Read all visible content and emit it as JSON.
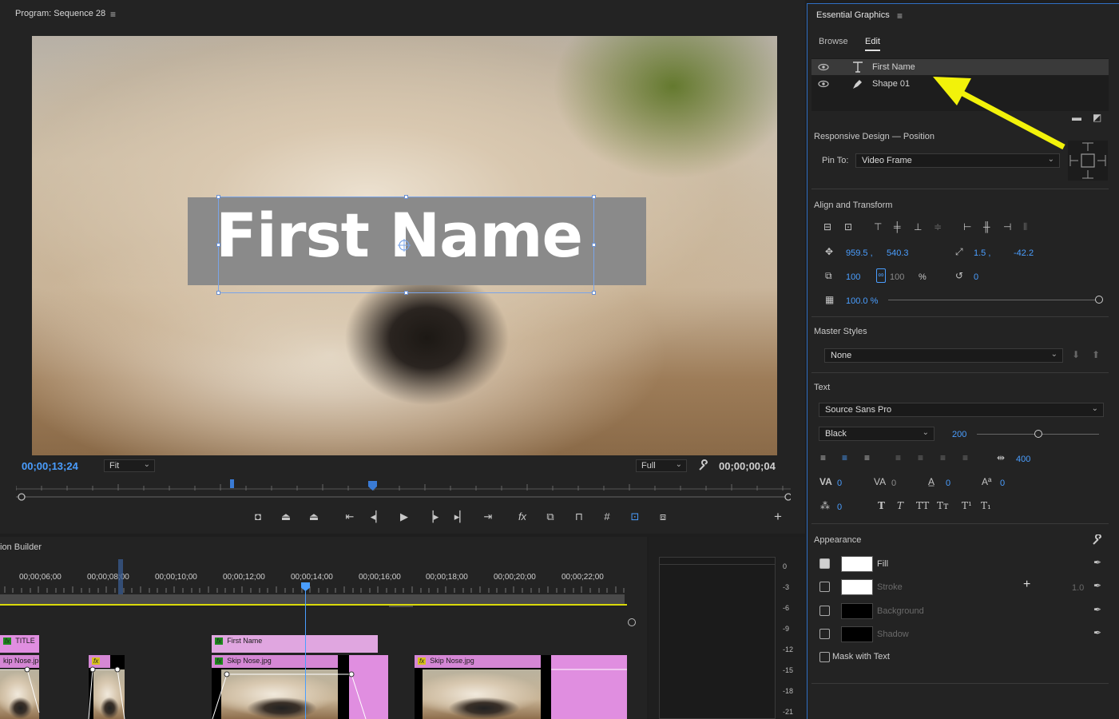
{
  "program": {
    "title": "Program: Sequence 28",
    "timecode_current": "00;00;13;24",
    "fit_value": "Fit",
    "resolution_value": "Full",
    "timecode_duration": "00;00;00;04",
    "title_overlay_text": "First Name"
  },
  "timeline": {
    "title": "ion Builder",
    "ruler_labels": [
      "00;00;06;00",
      "00;00;08;00",
      "00;00;10;00",
      "00;00;12;00",
      "00;00;14;00",
      "00;00;16;00",
      "00;00;18;00",
      "00;00;20;00",
      "00;00;22;00"
    ],
    "clips": {
      "title_clip": "TITLE",
      "first_name_clip": "First Name",
      "skip_nose_left": "kip Nose.jp",
      "skip_nose_mid": "Skip Nose.jpg",
      "skip_nose_right": "Skip Nose.jpg"
    },
    "fx_label": "fx"
  },
  "meter": {
    "labels": [
      "0",
      "-3",
      "-6",
      "-9",
      "-12",
      "-15",
      "-18",
      "-21"
    ]
  },
  "essential_graphics": {
    "title": "Essential Graphics",
    "tabs": [
      {
        "label": "Browse",
        "active": false
      },
      {
        "label": "Edit",
        "active": true
      }
    ],
    "layers": [
      {
        "name": "First Name",
        "icon": "text-tool-icon",
        "selected": true
      },
      {
        "name": "Shape 01",
        "icon": "pen-tool-icon",
        "selected": false
      }
    ],
    "responsive_design": {
      "title": "Responsive Design — Position",
      "pin_to_label": "Pin To:",
      "pin_to_value": "Video Frame"
    },
    "align_transform": {
      "title": "Align and Transform",
      "position_x": "959.5 ,",
      "position_y": "540.3",
      "anchor_x": "1.5 ,",
      "anchor_y": "-42.2",
      "scale_w": "100",
      "scale_h": "100",
      "scale_unit": "%",
      "rotation": "0",
      "opacity": "100.0 %"
    },
    "master_styles": {
      "title": "Master Styles",
      "value": "None"
    },
    "text": {
      "title": "Text",
      "font": "Source Sans Pro",
      "style": "Black",
      "size": "200",
      "tracking": "400",
      "kerning": "0",
      "tsume": "0",
      "leading": "0",
      "baseline_shift": "0",
      "rotation_val": "0",
      "tsume_label": "0"
    },
    "appearance": {
      "title": "Appearance",
      "fill": {
        "label": "Fill",
        "checked": true,
        "color": "#ffffff"
      },
      "stroke": {
        "label": "Stroke",
        "checked": false,
        "color": "#ffffff",
        "width": "1.0"
      },
      "background": {
        "label": "Background",
        "checked": false,
        "color": "#000000"
      },
      "shadow": {
        "label": "Shadow",
        "checked": false,
        "color": "#000000"
      },
      "mask_label": "Mask with Text"
    }
  },
  "colors": {
    "accent_blue": "#4a9eff",
    "annotation_yellow": "#f2f20a",
    "clip_pink": "#e08ee0"
  }
}
